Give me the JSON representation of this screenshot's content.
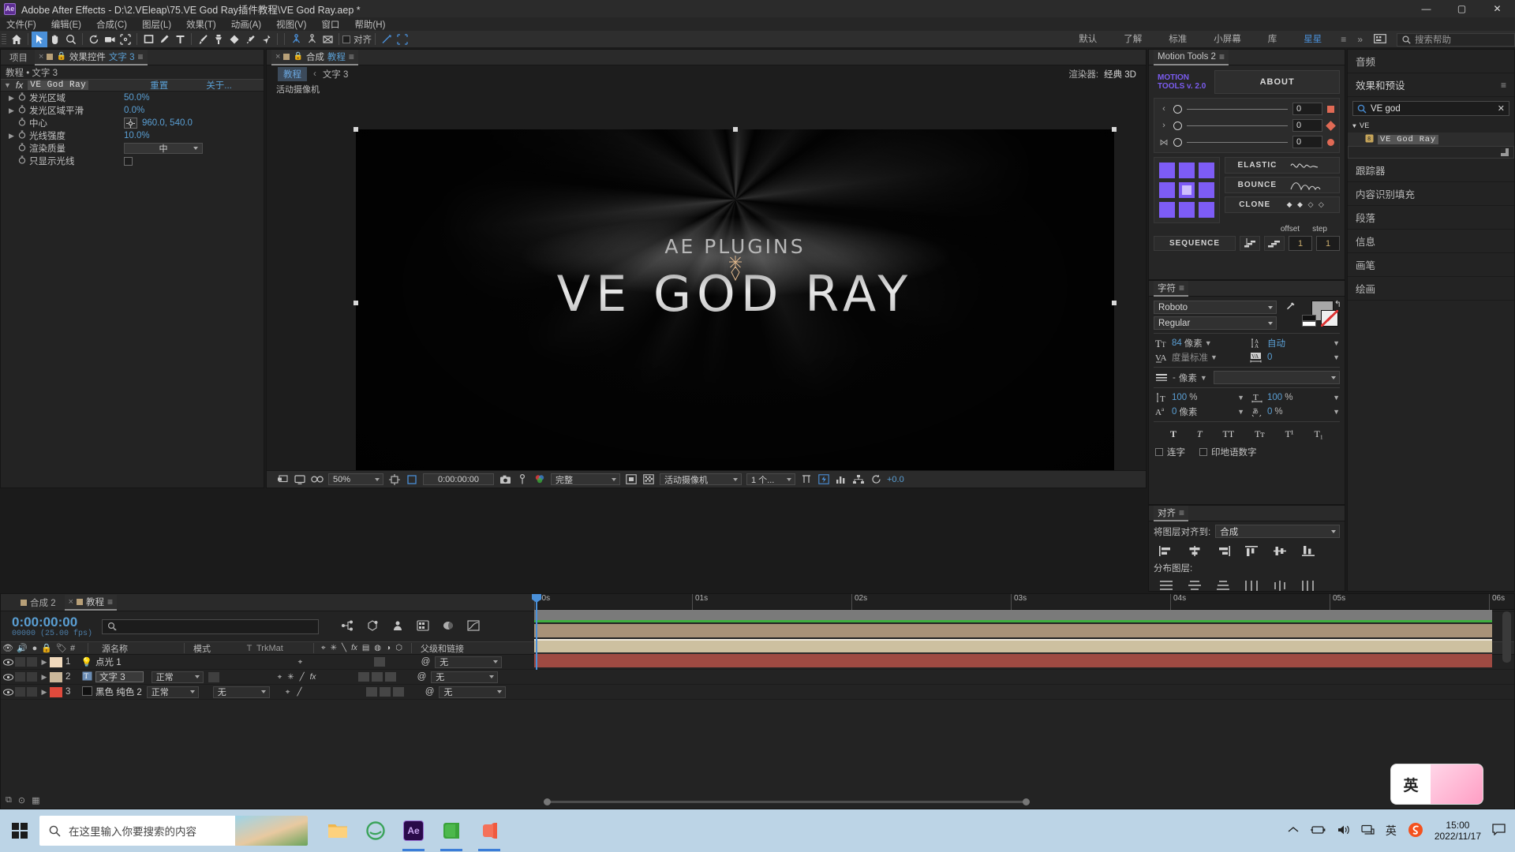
{
  "window": {
    "title": "Adobe After Effects - D:\\2.VEleap\\75.VE God Ray插件教程\\VE God Ray.aep *",
    "app_badge": "Ae",
    "minimize": "—",
    "maximize": "▢",
    "close": "✕"
  },
  "menubar": [
    "文件(F)",
    "编辑(E)",
    "合成(C)",
    "图层(L)",
    "效果(T)",
    "动画(A)",
    "视图(V)",
    "窗口",
    "帮助(H)"
  ],
  "toolbar": {
    "snap_label": "对齐",
    "tools": [
      {
        "name": "home-icon"
      },
      {
        "name": "selection-tool"
      },
      {
        "name": "hand-tool"
      },
      {
        "name": "zoom-tool"
      },
      {
        "name": "rotation-tool"
      },
      {
        "name": "camera-tool"
      },
      {
        "name": "anchor-point-tool"
      },
      {
        "name": "shape-tool"
      },
      {
        "name": "pen-tool"
      },
      {
        "name": "type-tool"
      },
      {
        "name": "brush-tool"
      },
      {
        "name": "clone-stamp-tool"
      },
      {
        "name": "eraser-tool"
      },
      {
        "name": "roto-brush-tool"
      },
      {
        "name": "puppet-pin-tool"
      }
    ],
    "workspaces": [
      "默认",
      "了解",
      "标准",
      "小屏幕",
      "库",
      "星星"
    ],
    "active_workspace": "星星",
    "overflow": "»",
    "help_placeholder": "搜索帮助"
  },
  "effect_controls": {
    "tabs": [
      {
        "label": "项目",
        "active": false
      },
      {
        "label": "效果控件",
        "suffix": "文字 3",
        "active": true
      }
    ],
    "breadcrumb": "教程 • 文字 3",
    "effect_name": "VE God Ray",
    "reset_label": "重置",
    "about_label": "关于...",
    "properties": [
      {
        "label": "发光区域",
        "value": "50.0%",
        "type": "number",
        "expandable": true
      },
      {
        "label": "发光区域平滑",
        "value": "0.0%",
        "type": "number",
        "expandable": true
      },
      {
        "label": "中心",
        "value": "960.0, 540.0",
        "type": "point",
        "expandable": false
      },
      {
        "label": "光线强度",
        "value": "10.0%",
        "type": "number",
        "expandable": true
      },
      {
        "label": "渲染质量",
        "value": "中",
        "type": "select",
        "expandable": false
      },
      {
        "label": "只显示光线",
        "value": "",
        "type": "checkbox",
        "checked": false,
        "expandable": false
      }
    ]
  },
  "composition": {
    "tabs": [
      {
        "label": "合成",
        "suffix": "教程",
        "active": true
      }
    ],
    "breadcrumb_root": "教程",
    "breadcrumb_sep": "‹",
    "breadcrumb_leaf": "文字 3",
    "renderer_label": "渲染器:",
    "renderer_value": "经典 3D",
    "view_label": "活动摄像机",
    "viewer_text_top": "AE PLUGINS",
    "viewer_text_main": "VE GOD RAY",
    "toolbar": {
      "zoom": "50%",
      "timecode": "0:00:00:00",
      "resolution": "完整",
      "camera_view": "活动摄像机",
      "views": "1 个...",
      "exposure": "+0.0"
    }
  },
  "motion_tools": {
    "panel_title": "Motion Tools 2",
    "brand_line1": "MOTION",
    "brand_line2": "TOOLS v. 2.0",
    "about": "ABOUT",
    "sliders": [
      {
        "icon": "chevron-left-icon",
        "value": "0",
        "marker": "square"
      },
      {
        "icon": "chevron-right-icon",
        "value": "0",
        "marker": "diamond"
      },
      {
        "icon": "close-cross-icon",
        "value": "0",
        "marker": "circle"
      }
    ],
    "buttons": [
      {
        "label": "ELASTIC",
        "glyph": "wave"
      },
      {
        "label": "BOUNCE",
        "glyph": "bounce"
      },
      {
        "label": "CLONE",
        "glyph": "◆ ◆ ◇ ◇"
      }
    ],
    "offset_label": "offset",
    "step_label": "step",
    "sequence_label": "SEQUENCE",
    "seq_offset": "1",
    "seq_step": "1",
    "anchor_grid_color": "#7d5cf5"
  },
  "character": {
    "panel_title": "字符",
    "font_family": "Roboto",
    "font_style": "Regular",
    "font_size": "84",
    "font_size_unit": "像素",
    "leading": "自动",
    "leading_icon": "auto-leading-icon",
    "kerning": "度量标准",
    "tracking": "0",
    "stroke_width": "-",
    "stroke_width_unit": "像素",
    "stroke_mode": "",
    "vertical_scale": "100",
    "vertical_scale_unit": "%",
    "horizontal_scale": "100",
    "horizontal_scale_unit": "%",
    "baseline_shift": "0",
    "baseline_shift_unit": "像素",
    "tsume": "0",
    "tsume_unit": "%",
    "styles": [
      "T",
      "T",
      "TT",
      "Tт",
      "T¹",
      "T₁"
    ],
    "ligatures_label": "连字",
    "hindi_label": "印地语数字"
  },
  "align": {
    "panel_title": "对齐",
    "align_to_label": "将图层对齐到:",
    "align_to_value": "合成",
    "distribute_label": "分布图层:"
  },
  "rail": {
    "items_top": [
      {
        "label": "音频",
        "name": "audio"
      }
    ],
    "effects_panel_title": "效果和预设",
    "search_value": "VE god",
    "search_clear": "✕",
    "tree_group": "VE",
    "tree_item": "VE God Ray",
    "items_bottom": [
      {
        "label": "跟踪器",
        "name": "tracker"
      },
      {
        "label": "内容识别填充",
        "name": "content-aware-fill"
      },
      {
        "label": "段落",
        "name": "paragraph"
      },
      {
        "label": "信息",
        "name": "info"
      },
      {
        "label": "画笔",
        "name": "brushes"
      },
      {
        "label": "绘画",
        "name": "paint"
      }
    ]
  },
  "timeline": {
    "tabs": [
      {
        "label": "合成 2",
        "active": false
      },
      {
        "label": "教程",
        "active": true
      }
    ],
    "current_time": "0:00:00:00",
    "frame_count": "00000",
    "fps": "(25.00 fps)",
    "search_placeholder": "",
    "columns": [
      "#",
      "源名称",
      "模式",
      "T",
      "TrkMat",
      "父级和链接"
    ],
    "layers": [
      {
        "index": "1",
        "name": "点光 1",
        "mode": "",
        "trkmat": "",
        "parent": "无",
        "color": "#e8cdae",
        "label_color": "#f0d9bc",
        "type": "light"
      },
      {
        "index": "2",
        "name": "文字 3",
        "mode": "正常",
        "trkmat": "",
        "parent": "无",
        "color": "#c4b094",
        "label_color": "#cbb89b",
        "type": "text",
        "selected": true
      },
      {
        "index": "3",
        "name": "黑色 纯色 2",
        "mode": "正常",
        "trkmat": "无",
        "parent": "无",
        "color": "#e04a3c",
        "label_color": "#9e4040",
        "type": "solid"
      }
    ],
    "ruler_ticks": [
      "00s",
      "01s",
      "02s",
      "03s",
      "04s",
      "05s",
      "06s"
    ]
  },
  "taskbar": {
    "search_placeholder": "在这里输入你要搜索的内容",
    "apps": [
      {
        "name": "file-explorer-icon",
        "running": false
      },
      {
        "name": "edge-icon",
        "running": false
      },
      {
        "name": "after-effects-icon",
        "running": true
      },
      {
        "name": "wechat-icon",
        "running": true
      },
      {
        "name": "qq-icon",
        "running": true
      }
    ],
    "tray": [
      "chevron-up-icon",
      "battery-icon",
      "volume-icon",
      "network-icon",
      "ime-icon",
      "sogou-icon"
    ],
    "time": "15:00",
    "date": "2022/11/17",
    "ime_badge": "英"
  }
}
